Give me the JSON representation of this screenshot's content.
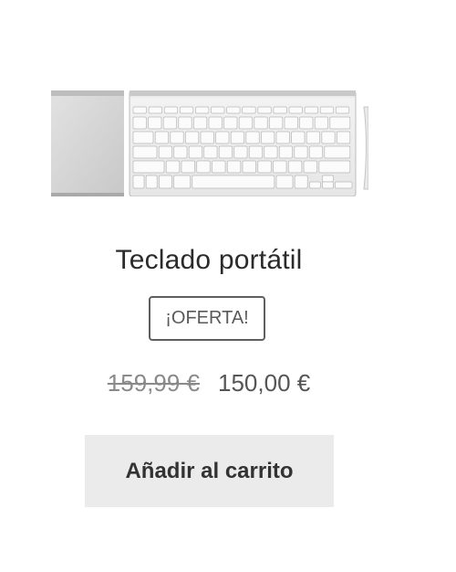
{
  "product": {
    "image_icon": "keyboard-trackpad-image",
    "title": "Teclado portátil",
    "badge": "¡OFERTA!",
    "price_regular": "159,99 €",
    "price_sale": "150,00 €",
    "add_to_cart_label": "Añadir al carrito"
  },
  "colors": {
    "title": "#2b2b2b",
    "price": "#555555",
    "button_bg": "#ebebeb"
  }
}
